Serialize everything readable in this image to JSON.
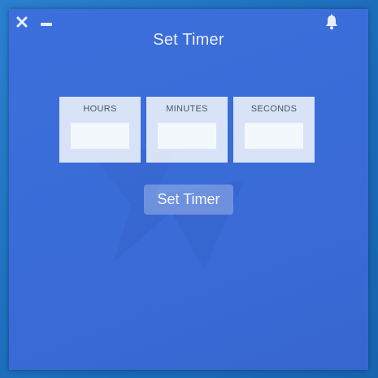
{
  "window": {
    "title": "Set Timer",
    "close_icon": "close-icon",
    "minimize_icon": "minimize-icon",
    "bell_icon": "bell-icon"
  },
  "fields": {
    "hours": {
      "label": "HOURS",
      "value": "",
      "placeholder": ""
    },
    "minutes": {
      "label": "MINUTES",
      "value": "",
      "placeholder": ""
    },
    "seconds": {
      "label": "SECONDS",
      "value": "",
      "placeholder": ""
    }
  },
  "actions": {
    "set_timer_label": "Set Timer"
  },
  "colors": {
    "window_bg": "#3b6dd9",
    "desktop_bg": "#1f74c4",
    "field_bg": "#eef4fa",
    "text_light": "#e8eefc"
  }
}
